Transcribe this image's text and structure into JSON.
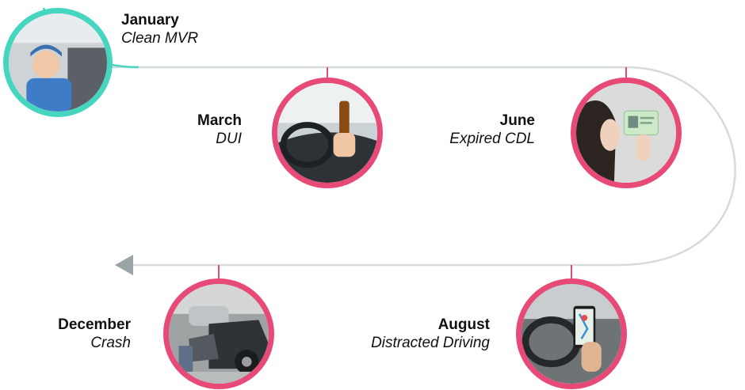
{
  "timeline": {
    "events": [
      {
        "month": "January",
        "event": "Clean MVR",
        "image": "truck-driver-smiling"
      },
      {
        "month": "March",
        "event": "DUI",
        "image": "hand-holding-beer-while-driving"
      },
      {
        "month": "June",
        "event": "Expired CDL",
        "image": "woman-holding-license-card"
      },
      {
        "month": "August",
        "event": "Distracted Driving",
        "image": "phone-map-while-driving"
      },
      {
        "month": "December",
        "event": "Crash",
        "image": "car-crash-scene"
      }
    ],
    "colors": {
      "track": "#d7dadb",
      "arrow": "#9aa3a6",
      "clean": "#46d6bf",
      "violation": "#e84a78"
    }
  }
}
